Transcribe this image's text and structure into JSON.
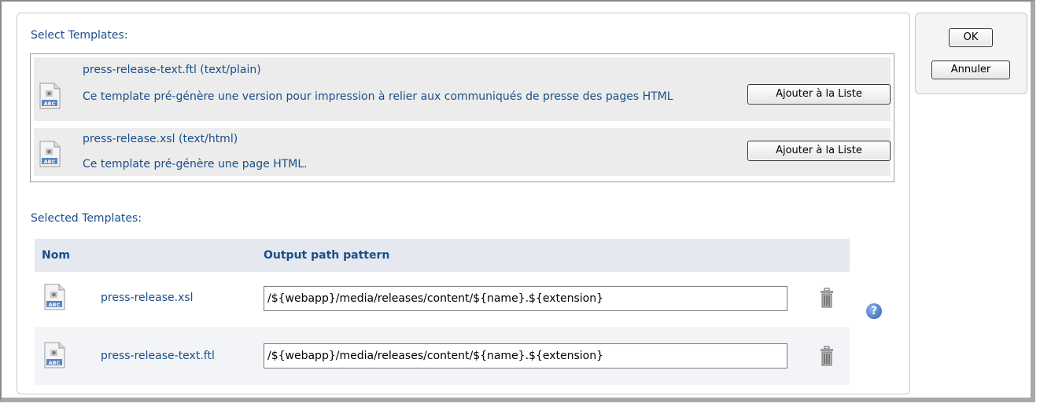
{
  "select_section": {
    "title": "Select Templates:",
    "items": [
      {
        "name": "press-release-text.ftl (text/plain)",
        "description": "Ce template pré-génère une version pour impression à relier aux communiqués de presse des pages HTML",
        "button": "Ajouter à la Liste"
      },
      {
        "name": "press-release.xsl (text/html)",
        "description": "Ce template pré-génère une page HTML.",
        "button": "Ajouter à la Liste"
      }
    ]
  },
  "selected_section": {
    "title": "Selected Templates:",
    "columns": [
      "Nom",
      "Output path pattern"
    ],
    "rows": [
      {
        "name": "press-release.xsl",
        "path": "/${webapp}/media/releases/content/${name}.${extension}"
      },
      {
        "name": "press-release-text.ftl",
        "path": "/${webapp}/media/releases/content/${name}.${extension}"
      }
    ],
    "help_label": "?"
  },
  "actions": {
    "ok_label": "OK",
    "cancel_label": "Annuler"
  },
  "icons": {
    "template_file": "template-file-icon",
    "delete": "trash-icon",
    "help": "help-icon"
  },
  "colors": {
    "text": "#1a4e8a",
    "row_bg": "#ececec",
    "table_header_bg": "#e5e9ef",
    "alt_row_bg": "#f2f4f7"
  }
}
